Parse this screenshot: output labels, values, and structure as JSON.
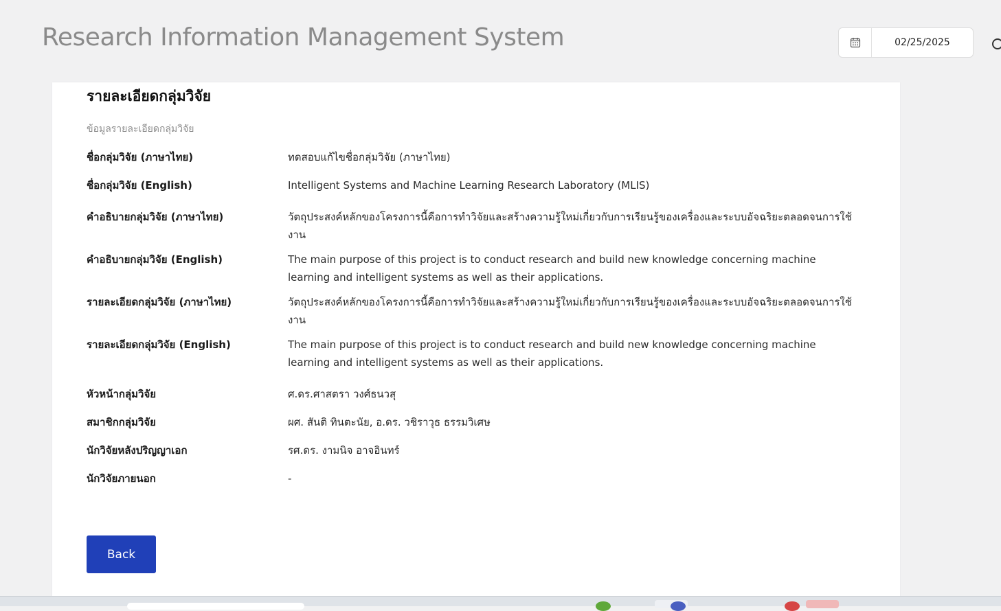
{
  "header": {
    "title": "Research Information Management System",
    "date": "02/25/2025"
  },
  "card": {
    "title": "รายละเอียดกลุ่มวิจัย",
    "section_subtitle": "ข้อมูลรายละเอียดกลุ่มวิจัย",
    "fields": [
      {
        "label": "ชื่อกลุ่มวิจัย (ภาษาไทย)",
        "value": "ทดสอบแก้ไขชื่อกลุ่มวิจัย (ภาษาไทย)"
      },
      {
        "label": "ชื่อกลุ่มวิจัย (English)",
        "value": "Intelligent Systems and Machine Learning Research Laboratory (MLIS)"
      },
      {
        "label": "คำอธิบายกลุ่มวิจัย (ภาษาไทย)",
        "value": "วัตถุประสงค์หลักของโครงการนี้คือการทำวิจัยและสร้างความรู้ใหม่เกี่ยวกับการเรียนรู้ของเครื่องและระบบอัจฉริยะตลอดจนการใช้งาน"
      },
      {
        "label": "คำอธิบายกลุ่มวิจัย (English)",
        "value": "The main purpose of this project is to conduct research and build new knowledge concerning machine learning and intelligent systems as well as their applications."
      },
      {
        "label": "รายละเอียดกลุ่มวิจัย (ภาษาไทย)",
        "value": "วัตถุประสงค์หลักของโครงการนี้คือการทำวิจัยและสร้างความรู้ใหม่เกี่ยวกับการเรียนรู้ของเครื่องและระบบอัจฉริยะตลอดจนการใช้งาน"
      },
      {
        "label": "รายละเอียดกลุ่มวิจัย (English)",
        "value": "The main purpose of this project is to conduct research and build new knowledge concerning machine learning and intelligent systems as well as their applications."
      },
      {
        "label": "หัวหน้ากลุ่มวิจัย",
        "value": "ศ.ดร.ศาสตรา วงศ์ธนวสุ"
      },
      {
        "label": "สมาชิกกลุ่มวิจัย",
        "value": "ผศ. สันติ ทินตะนัย, อ.ดร. วชิราวุธ ธรรมวิเศษ"
      },
      {
        "label": "นักวิจัยหลังปริญญาเอก",
        "value": "รศ.ดร. งามนิจ อาจอินทร์"
      },
      {
        "label": "นักวิจัยภายนอก",
        "value": "-"
      }
    ],
    "back_label": "Back"
  },
  "colors": {
    "primary": "#2040b8",
    "background": "#f1f1f2"
  }
}
